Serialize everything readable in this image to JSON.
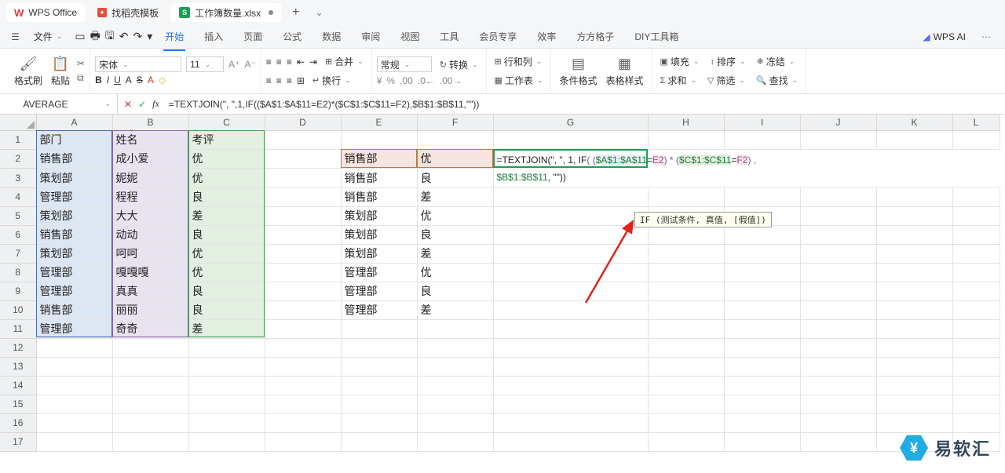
{
  "titlebar": {
    "app": "WPS Office",
    "template_tab": "找稻壳模板",
    "file_tab": "工作簿数量.xlsx",
    "plus": "+"
  },
  "menubar": {
    "menu": "☰",
    "file": "文件",
    "qat": [
      "▭",
      "🖶",
      "🖫",
      "↶",
      "↷",
      "▾"
    ],
    "tabs": [
      "开始",
      "插入",
      "页面",
      "公式",
      "数据",
      "审阅",
      "视图",
      "工具",
      "会员专享",
      "效率",
      "方方格子",
      "DIY工具箱"
    ],
    "active_tab_index": 0,
    "wps_ai": "WPS AI"
  },
  "ribbon": {
    "brush": "格式刷",
    "paste": "粘贴",
    "font_name": "宋体",
    "font_size": "11",
    "bold": "B",
    "italic": "I",
    "underline": "U",
    "aa": "A",
    "strike": "S",
    "fontcolor": "A",
    "bgcolor": "◇",
    "align_icons": [
      "≡",
      "≡",
      "≡",
      "≡",
      "≡",
      "≡"
    ],
    "merge": "合并",
    "wrap": "换行",
    "number_fmt": "常规",
    "cvt": "转换",
    "row_col": "行和列",
    "worksheet": "工作表",
    "cond_fmt": "条件格式",
    "table_style": "表格样式",
    "fill": "填充",
    "sort": "排序",
    "freeze": "冻结",
    "sum": "求和",
    "filter": "筛选",
    "find": "查找"
  },
  "formula_bar": {
    "name": "AVERAGE",
    "formula": "=TEXTJOIN(\", \",1,IF(($A$1:$A$11=E2)*($C$1:$C$11=F2),$B$1:$B$11,\"\"))"
  },
  "columns": [
    "A",
    "B",
    "C",
    "D",
    "E",
    "F",
    "G",
    "H",
    "I",
    "J",
    "K",
    "L"
  ],
  "rows": [
    1,
    2,
    3,
    4,
    5,
    6,
    7,
    8,
    9,
    10,
    11,
    12,
    13,
    14,
    15,
    16,
    17
  ],
  "data": {
    "A": [
      "部门",
      "销售部",
      "策划部",
      "管理部",
      "策划部",
      "销售部",
      "策划部",
      "管理部",
      "管理部",
      "销售部",
      "管理部"
    ],
    "B": [
      "姓名",
      "成小爱",
      "妮妮",
      "程程",
      "大大",
      "动动",
      "呵呵",
      "嘎嘎嘎",
      "真真",
      "丽丽",
      "奇奇"
    ],
    "C": [
      "考评",
      "优",
      "优",
      "良",
      "差",
      "良",
      "优",
      "优",
      "良",
      "良",
      "差"
    ],
    "E": [
      "",
      "销售部",
      "销售部",
      "销售部",
      "策划部",
      "策划部",
      "策划部",
      "管理部",
      "管理部",
      "管理部"
    ],
    "F": [
      "",
      "优",
      "良",
      "差",
      "优",
      "良",
      "差",
      "优",
      "良",
      "差"
    ]
  },
  "edit": {
    "pre": "=TEXTJOIN(\", \", 1, IF",
    "r1": "$A$1:$A$11",
    "eq1": "=",
    "r2": "E2",
    "mul": ") * (",
    "r3": "$C$1:$C$11",
    "eq2": "=",
    "r4": "F2",
    "post": ") ,",
    "line2a": "$B$1:$B$11",
    "line2b": ", \"\"))"
  },
  "tooltip": "IF (测试条件, 真值, [假值])",
  "watermark": "易软汇",
  "chart_data": {
    "type": "table",
    "title": "",
    "headers": [
      "部门",
      "姓名",
      "考评"
    ],
    "rows": [
      [
        "销售部",
        "成小爱",
        "优"
      ],
      [
        "策划部",
        "妮妮",
        "优"
      ],
      [
        "管理部",
        "程程",
        "良"
      ],
      [
        "策划部",
        "大大",
        "差"
      ],
      [
        "销售部",
        "动动",
        "良"
      ],
      [
        "策划部",
        "呵呵",
        "优"
      ],
      [
        "管理部",
        "嘎嘎嘎",
        "优"
      ],
      [
        "管理部",
        "真真",
        "良"
      ],
      [
        "销售部",
        "丽丽",
        "良"
      ],
      [
        "管理部",
        "奇奇",
        "差"
      ]
    ],
    "lookup_headers": [
      "部门",
      "考评"
    ],
    "lookup_rows": [
      [
        "销售部",
        "优"
      ],
      [
        "销售部",
        "良"
      ],
      [
        "销售部",
        "差"
      ],
      [
        "策划部",
        "优"
      ],
      [
        "策划部",
        "良"
      ],
      [
        "策划部",
        "差"
      ],
      [
        "管理部",
        "优"
      ],
      [
        "管理部",
        "良"
      ],
      [
        "管理部",
        "差"
      ]
    ],
    "active_formula": "=TEXTJOIN(\", \",1,IF(($A$1:$A$11=E2)*($C$1:$C$11=F2),$B$1:$B$11,\"\"))"
  }
}
